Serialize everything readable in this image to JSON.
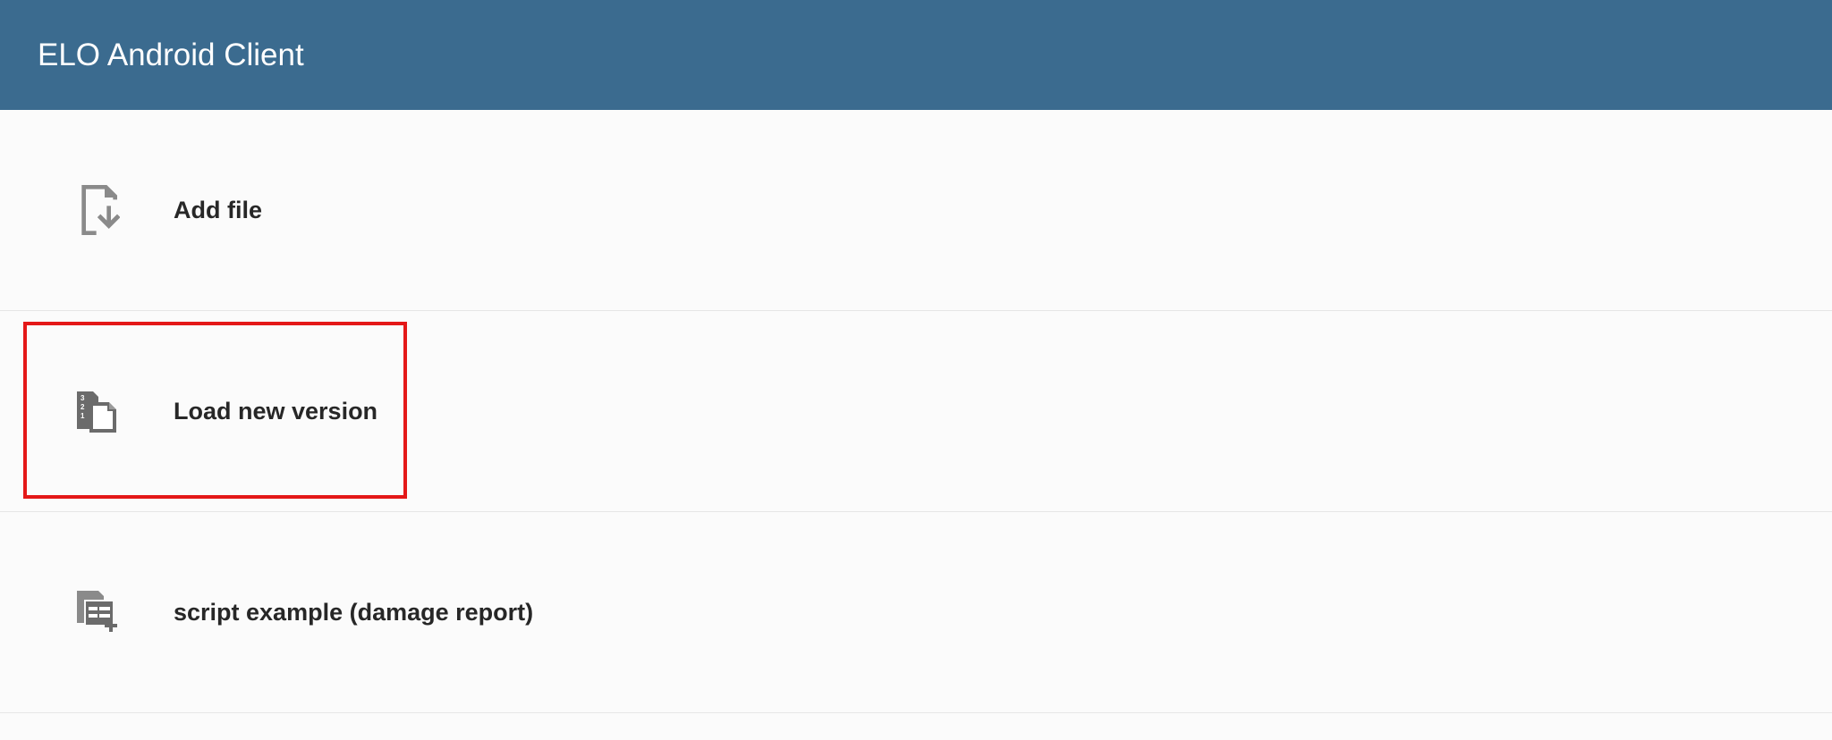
{
  "header": {
    "title": "ELO Android Client"
  },
  "menu": {
    "items": [
      {
        "label": "Add file",
        "highlighted": false
      },
      {
        "label": "Load new version",
        "highlighted": true
      },
      {
        "label": "script  example (damage report)",
        "highlighted": false
      }
    ]
  }
}
